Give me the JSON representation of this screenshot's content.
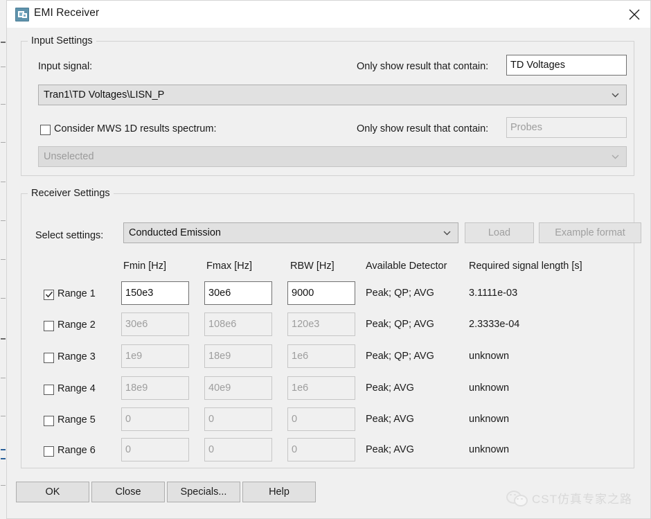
{
  "window": {
    "title": "EMI Receiver",
    "icon": "emi-receiver-icon",
    "close_icon": "close-icon"
  },
  "input_settings": {
    "legend": "Input Settings",
    "input_signal_label": "Input signal:",
    "input_signal_value": "Tran1\\TD Voltages\\LISN_P",
    "filter1_label": "Only show result that contain:",
    "filter1_value": "TD Voltages",
    "consider_checkbox_label": "Consider MWS 1D results spectrum:",
    "consider_checkbox_checked": false,
    "spectrum_value": "Unselected",
    "filter2_label": "Only show result that contain:",
    "filter2_value": "Probes"
  },
  "receiver_settings": {
    "legend": "Receiver Settings",
    "select_settings_label": "Select settings:",
    "select_settings_value": "Conducted Emission",
    "load_button": "Load",
    "example_format_button": "Example format",
    "columns": [
      "Fmin [Hz]",
      "Fmax [Hz]",
      "RBW [Hz]",
      "Available Detector",
      "Required signal length [s]"
    ],
    "rows": [
      {
        "label": "Range 1",
        "checked": true,
        "enabled": true,
        "fmin": "150e3",
        "fmax": "30e6",
        "rbw": "9000",
        "detector": "Peak; QP; AVG",
        "length": "3.1111e-03"
      },
      {
        "label": "Range 2",
        "checked": false,
        "enabled": false,
        "fmin": "30e6",
        "fmax": "108e6",
        "rbw": "120e3",
        "detector": "Peak; QP; AVG",
        "length": "2.3333e-04"
      },
      {
        "label": "Range 3",
        "checked": false,
        "enabled": false,
        "fmin": "1e9",
        "fmax": "18e9",
        "rbw": "1e6",
        "detector": "Peak; QP; AVG",
        "length": "unknown"
      },
      {
        "label": "Range 4",
        "checked": false,
        "enabled": false,
        "fmin": "18e9",
        "fmax": "40e9",
        "rbw": "1e6",
        "detector": "Peak; AVG",
        "length": "unknown"
      },
      {
        "label": "Range 5",
        "checked": false,
        "enabled": false,
        "fmin": "0",
        "fmax": "0",
        "rbw": "0",
        "detector": "Peak; AVG",
        "length": "unknown"
      },
      {
        "label": "Range 6",
        "checked": false,
        "enabled": false,
        "fmin": "0",
        "fmax": "0",
        "rbw": "0",
        "detector": "Peak; AVG",
        "length": "unknown"
      }
    ]
  },
  "footer": {
    "ok": "OK",
    "close": "Close",
    "specials": "Specials...",
    "help": "Help"
  },
  "watermark": {
    "text": "CST仿真专家之路",
    "icon": "wechat-icon"
  },
  "colors": {
    "accent": "#5f93ac",
    "dialog_bg": "#f0f0f0",
    "titlebar_bg": "#ffffff",
    "disabled_text": "#9d9d9d",
    "text": "#1a1a1a"
  }
}
